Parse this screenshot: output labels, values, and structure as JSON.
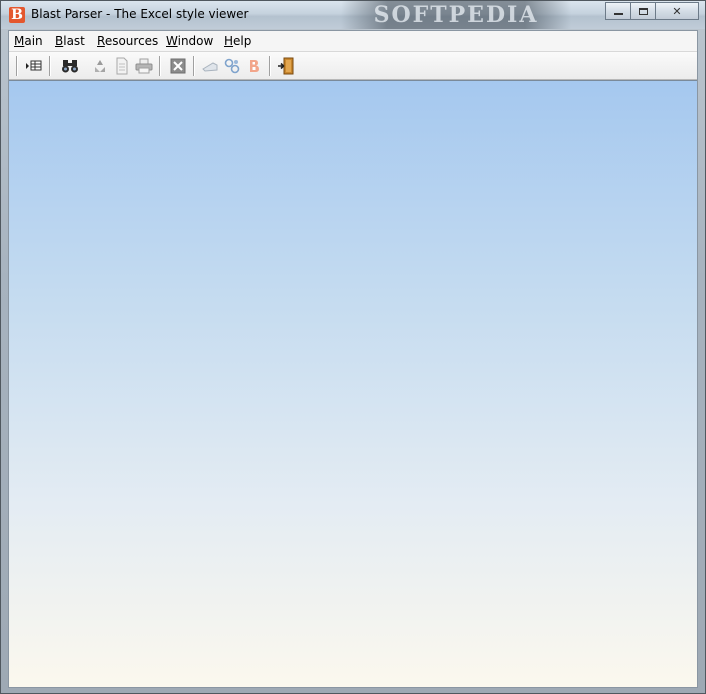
{
  "window": {
    "title": "Blast Parser - The Excel style viewer",
    "app_icon_letter": "B",
    "watermark": "SOFTPEDIA",
    "caption": {
      "minimize_label": "",
      "maximize_label": "",
      "close_label": "✕"
    }
  },
  "menubar": {
    "items": [
      {
        "label": "Main",
        "mnemonic": "M"
      },
      {
        "label": "Blast",
        "mnemonic": "B"
      },
      {
        "label": "Resources",
        "mnemonic": "R"
      },
      {
        "label": "Window",
        "mnemonic": "W"
      },
      {
        "label": "Help",
        "mnemonic": "H"
      }
    ]
  },
  "toolbar": {
    "buttons": [
      {
        "icon": "open-table-icon",
        "enabled": true
      },
      {
        "icon": "binoculars-icon",
        "enabled": true
      },
      {
        "icon": "recycle-icon",
        "enabled": false
      },
      {
        "icon": "document-icon",
        "enabled": false
      },
      {
        "icon": "print-icon",
        "enabled": false
      },
      {
        "icon": "excel-icon",
        "enabled": false
      },
      {
        "icon": "eraser-icon",
        "enabled": false
      },
      {
        "icon": "link-icon",
        "enabled": false
      },
      {
        "icon": "blast-icon",
        "enabled": false
      },
      {
        "icon": "exit-door-icon",
        "enabled": true
      }
    ]
  },
  "colors": {
    "desktop_top": "#a5c8ef",
    "desktop_bottom": "#fbf8ee",
    "app_icon": "#e4572e"
  }
}
